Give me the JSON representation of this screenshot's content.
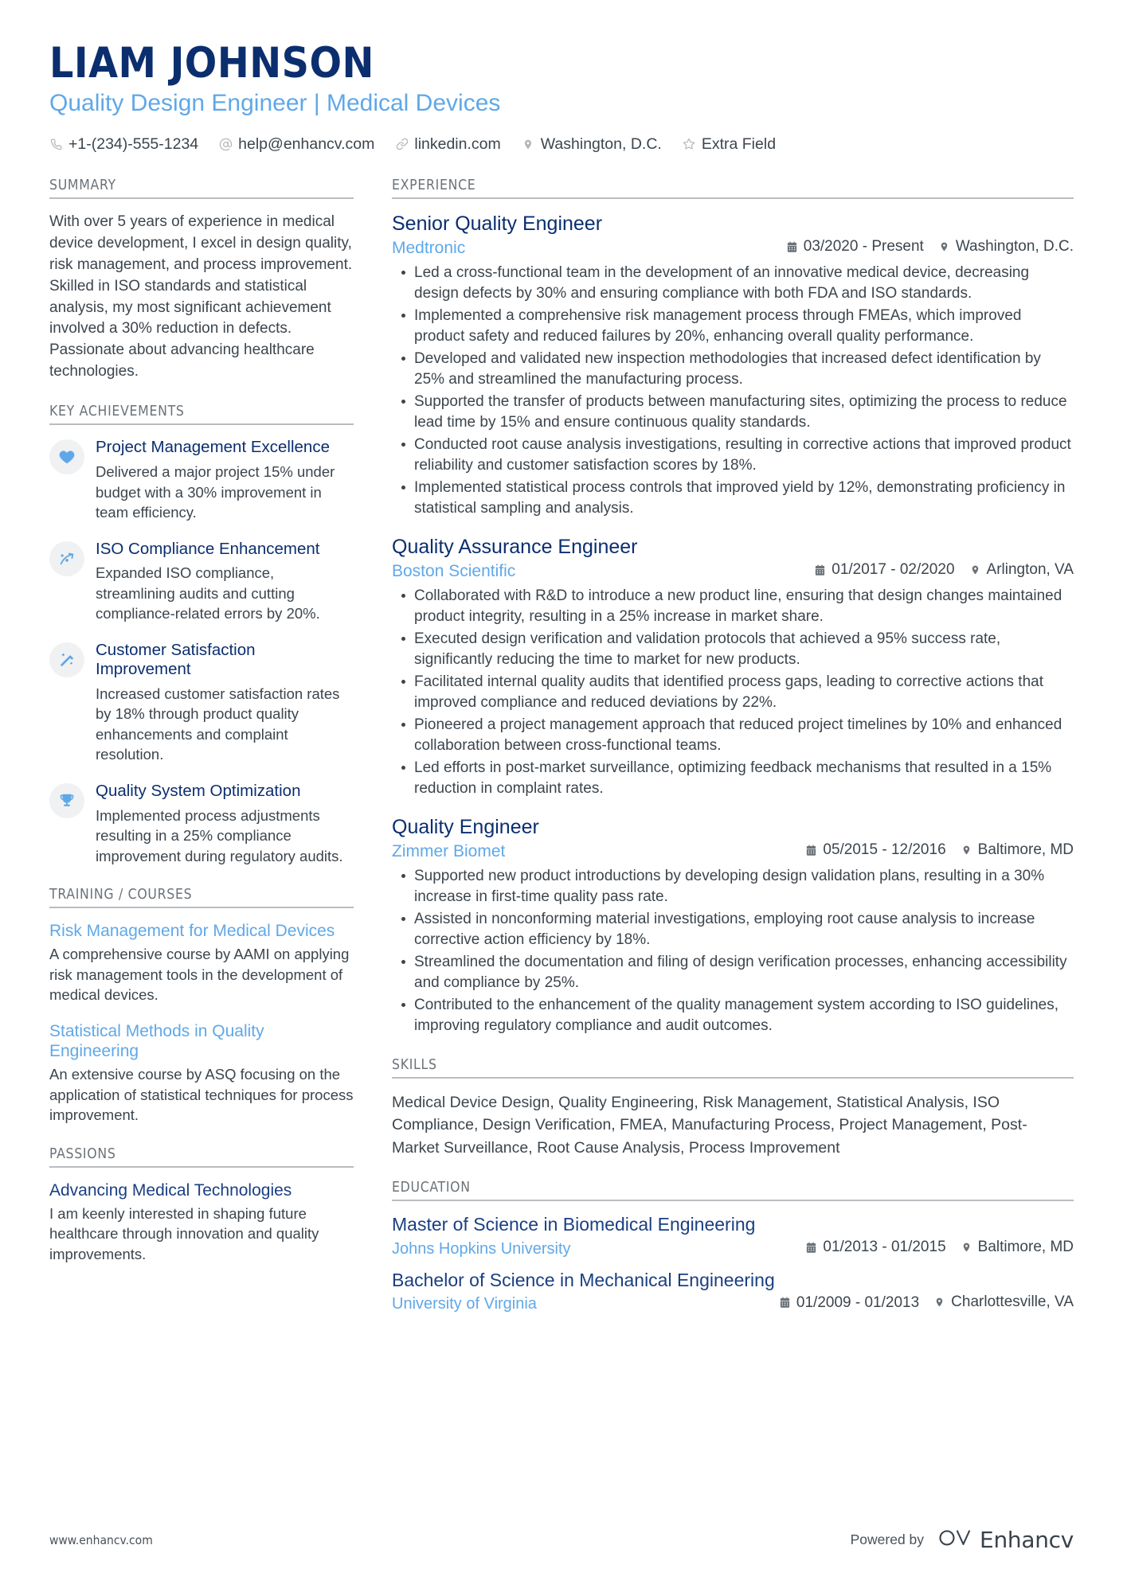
{
  "header": {
    "name": "LIAM JOHNSON",
    "title": "Quality Design Engineer | Medical Devices",
    "contacts": [
      {
        "icon": "phone-icon",
        "text": "+1-(234)-555-1234"
      },
      {
        "icon": "at-sign-icon",
        "text": "help@enhancv.com"
      },
      {
        "icon": "link-icon",
        "text": "linkedin.com"
      },
      {
        "icon": "location-pin-icon",
        "text": "Washington, D.C."
      },
      {
        "icon": "star-icon",
        "text": "Extra Field"
      }
    ]
  },
  "colors": {
    "navy": "#0b2e6f",
    "light_blue": "#5fa8e8",
    "body_text": "#3c454d",
    "section_rule": "#b9bcbf",
    "icon_circle": "#f0f1f2"
  },
  "sections": {
    "summary": {
      "heading": "SUMMARY",
      "text": "With over 5 years of experience in medical device development, I excel in design quality, risk management, and process improvement. Skilled in ISO standards and statistical analysis, my most significant achievement involved a 30% reduction in defects. Passionate about advancing healthcare technologies."
    },
    "key_achievements": {
      "heading": "KEY ACHIEVEMENTS",
      "items": [
        {
          "icon": "heart-icon",
          "title": "Project Management Excellence",
          "description": "Delivered a major project 15% under budget with a 30% improvement in team efficiency."
        },
        {
          "icon": "strategy-arrow-icon",
          "title": "ISO Compliance Enhancement",
          "description": "Expanded ISO compliance, streamlining audits and cutting compliance-related errors by 20%."
        },
        {
          "icon": "magic-wand-icon",
          "title": "Customer Satisfaction Improvement",
          "description": "Increased customer satisfaction rates by 18% through product quality enhancements and complaint resolution."
        },
        {
          "icon": "trophy-icon",
          "title": "Quality System Optimization",
          "description": "Implemented process adjustments resulting in a 25% compliance improvement during regulatory audits."
        }
      ]
    },
    "training": {
      "heading": "TRAINING / COURSES",
      "items": [
        {
          "title": "Risk Management for Medical Devices",
          "description": "A comprehensive course by AAMI on applying risk management tools in the development of medical devices."
        },
        {
          "title": "Statistical Methods in Quality Engineering",
          "description": "An extensive course by ASQ focusing on the application of statistical techniques for process improvement."
        }
      ]
    },
    "passions": {
      "heading": "PASSIONS",
      "items": [
        {
          "title": "Advancing Medical Technologies",
          "description": "I am keenly interested in shaping future healthcare through innovation and quality improvements."
        }
      ]
    },
    "experience": {
      "heading": "EXPERIENCE",
      "jobs": [
        {
          "title": "Senior Quality Engineer",
          "company": "Medtronic",
          "date": "03/2020 - Present",
          "location": "Washington, D.C.",
          "bullets": [
            "Led a cross-functional team in the development of an innovative medical device, decreasing design defects by 30% and ensuring compliance with both FDA and ISO standards.",
            "Implemented a comprehensive risk management process through FMEAs, which improved product safety and reduced failures by 20%, enhancing overall quality performance.",
            "Developed and validated new inspection methodologies that increased defect identification by 25% and streamlined the manufacturing process.",
            "Supported the transfer of products between manufacturing sites, optimizing the process to reduce lead time by 15% and ensure continuous quality standards.",
            "Conducted root cause analysis investigations, resulting in corrective actions that improved product reliability and customer satisfaction scores by 18%.",
            "Implemented statistical process controls that improved yield by 12%, demonstrating proficiency in statistical sampling and analysis."
          ]
        },
        {
          "title": "Quality Assurance Engineer",
          "company": "Boston Scientific",
          "date": "01/2017 - 02/2020",
          "location": "Arlington, VA",
          "bullets": [
            "Collaborated with R&D to introduce a new product line, ensuring that design changes maintained product integrity, resulting in a 25% increase in market share.",
            "Executed design verification and validation protocols that achieved a 95% success rate, significantly reducing the time to market for new products.",
            "Facilitated internal quality audits that identified process gaps, leading to corrective actions that improved compliance and reduced deviations by 22%.",
            "Pioneered a project management approach that reduced project timelines by 10% and enhanced collaboration between cross-functional teams.",
            "Led efforts in post-market surveillance, optimizing feedback mechanisms that resulted in a 15% reduction in complaint rates."
          ]
        },
        {
          "title": "Quality Engineer",
          "company": "Zimmer Biomet",
          "date": "05/2015 - 12/2016",
          "location": "Baltimore, MD",
          "bullets": [
            "Supported new product introductions by developing design validation plans, resulting in a 30% increase in first-time quality pass rate.",
            "Assisted in nonconforming material investigations, employing root cause analysis to increase corrective action efficiency by 18%.",
            "Streamlined the documentation and filing of design verification processes, enhancing accessibility and compliance by 25%.",
            "Contributed to the enhancement of the quality management system according to ISO guidelines, improving regulatory compliance and audit outcomes."
          ]
        }
      ]
    },
    "skills": {
      "heading": "SKILLS",
      "text": "Medical Device Design, Quality Engineering, Risk Management, Statistical Analysis, ISO Compliance, Design Verification, FMEA, Manufacturing Process, Project Management, Post-Market Surveillance, Root Cause Analysis, Process Improvement"
    },
    "education": {
      "heading": "EDUCATION",
      "items": [
        {
          "degree": "Master of Science in Biomedical Engineering",
          "school": "Johns Hopkins University",
          "date": "01/2013 - 01/2015",
          "location": "Baltimore, MD"
        },
        {
          "degree": "Bachelor of Science in Mechanical Engineering",
          "school": "University of Virginia",
          "date": "01/2009 - 01/2013",
          "location": "Charlottesville, VA"
        }
      ]
    }
  },
  "footer": {
    "url": "www.enhancv.com",
    "powered_by": "Powered by",
    "brand": "Enhancv"
  }
}
